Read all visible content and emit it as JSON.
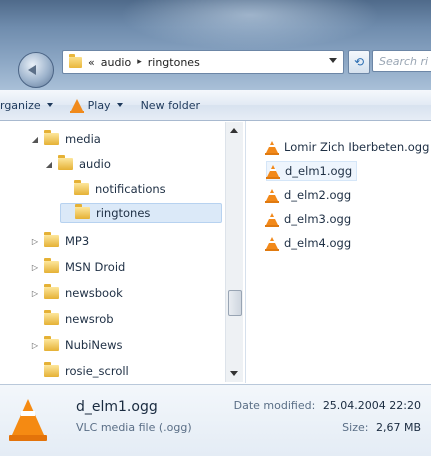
{
  "address": {
    "crumbs": [
      "«",
      "audio",
      "ringtones"
    ],
    "separator": "▸",
    "search_placeholder": "Search ri"
  },
  "toolbar": {
    "organize_label": "rganize",
    "play_label": "Play",
    "new_folder_label": "New folder"
  },
  "nav": {
    "items": [
      {
        "label": "media",
        "expander": "◢"
      },
      {
        "label": "audio",
        "expander": "◢"
      },
      {
        "label": "notifications",
        "expander": ""
      },
      {
        "label": "ringtones",
        "expander": ""
      },
      {
        "label": "MP3",
        "expander": "▷"
      },
      {
        "label": "MSN Droid",
        "expander": "▷"
      },
      {
        "label": "newsbook",
        "expander": "▷"
      },
      {
        "label": "newsrob",
        "expander": ""
      },
      {
        "label": "NubiNews",
        "expander": "▷"
      },
      {
        "label": "rosie_scroll",
        "expander": ""
      }
    ],
    "selected": "ringtones"
  },
  "files": [
    {
      "name": "Lomir Zich Iberbeten.ogg",
      "icon": "vlc-cone-icon"
    },
    {
      "name": "d_elm1.ogg",
      "icon": "vlc-cone-icon"
    },
    {
      "name": "d_elm2.ogg",
      "icon": "vlc-cone-icon"
    },
    {
      "name": "d_elm3.ogg",
      "icon": "vlc-cone-icon"
    },
    {
      "name": "d_elm4.ogg",
      "icon": "vlc-cone-icon"
    }
  ],
  "details": {
    "name": "d_elm1.ogg",
    "type": "VLC media file (.ogg)",
    "modified_label": "Date modified:",
    "modified_value": "25.04.2004 22:20",
    "size_label": "Size:",
    "size_value": "2,67 MB"
  },
  "colors": {
    "vlc_orange": "#f2891a",
    "selection": "#dbe9f8",
    "folder": "#e5b135"
  }
}
